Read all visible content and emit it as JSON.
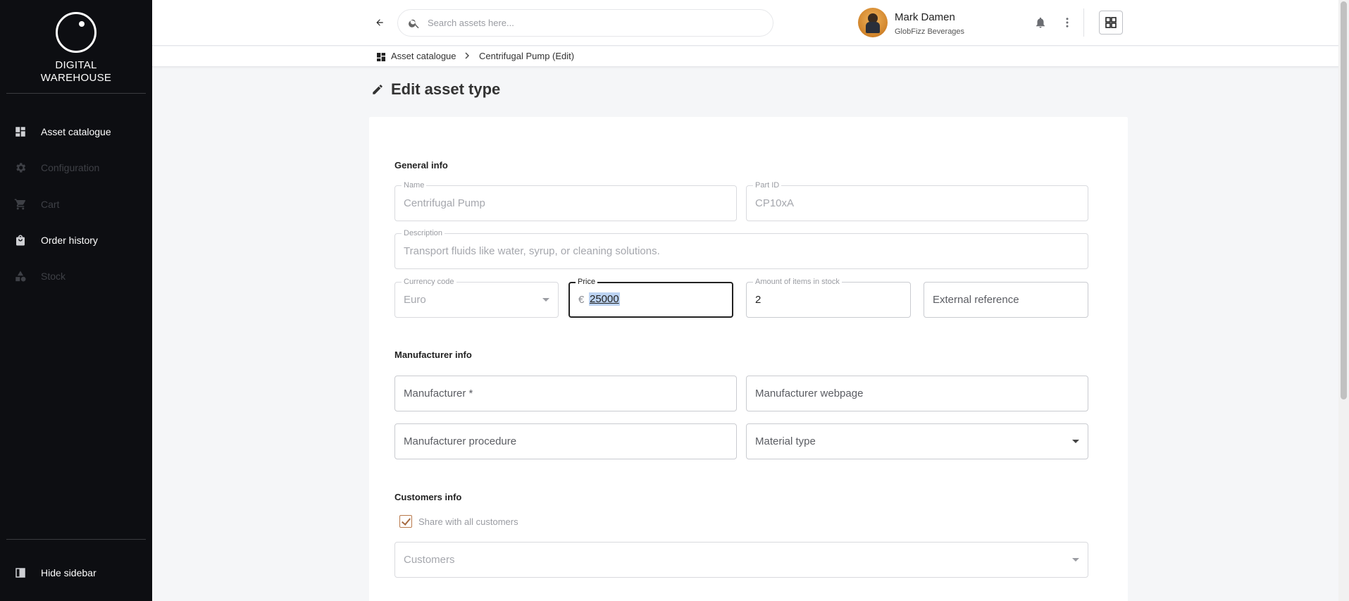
{
  "app": {
    "logo_line1": "DIGITAL",
    "logo_line2": "WAREHOUSE"
  },
  "sidebar": {
    "items": [
      {
        "label": "Asset catalogue",
        "icon": "dashboard-icon",
        "enabled": true
      },
      {
        "label": "Configuration",
        "icon": "gear-icon",
        "enabled": false
      },
      {
        "label": "Cart",
        "icon": "cart-icon",
        "enabled": false
      },
      {
        "label": "Order history",
        "icon": "bag-icon",
        "enabled": true
      },
      {
        "label": "Stock",
        "icon": "shapes-icon",
        "enabled": false
      }
    ],
    "hide_label": "Hide sidebar"
  },
  "header": {
    "search_placeholder": "Search assets here...",
    "user_name": "Mark Damen",
    "user_org": "GlobFizz Beverages"
  },
  "breadcrumb": {
    "root": "Asset catalogue",
    "separator": ">",
    "current": "Centrifugal Pump (Edit)"
  },
  "page": {
    "title": "Edit asset type"
  },
  "form": {
    "general": {
      "title": "General info",
      "name_label": "Name",
      "name_value": "Centrifugal Pump",
      "part_id_label": "Part ID",
      "part_id_value": "CP10xA",
      "description_label": "Description",
      "description_value": "Transport fluids like water, syrup, or cleaning solutions.",
      "currency_label": "Currency code",
      "currency_value": "Euro",
      "price_label": "Price",
      "price_symbol": "€",
      "price_value": "25000",
      "stock_label": "Amount of items in stock",
      "stock_value": "2",
      "external_ref_placeholder": "External reference"
    },
    "manufacturer": {
      "title": "Manufacturer info",
      "manufacturer_placeholder": "Manufacturer *",
      "webpage_placeholder": "Manufacturer webpage",
      "procedure_placeholder": "Manufacturer procedure",
      "material_placeholder": "Material type"
    },
    "customers": {
      "title": "Customers info",
      "share_label": "Share with all customers",
      "share_checked": true,
      "customers_placeholder": "Customers"
    }
  },
  "colors": {
    "sidebar_bg": "#0d0e12",
    "page_bg": "#f5f6f8",
    "checkbox_accent": "#a66a40",
    "selection": "#bcd3f2"
  }
}
